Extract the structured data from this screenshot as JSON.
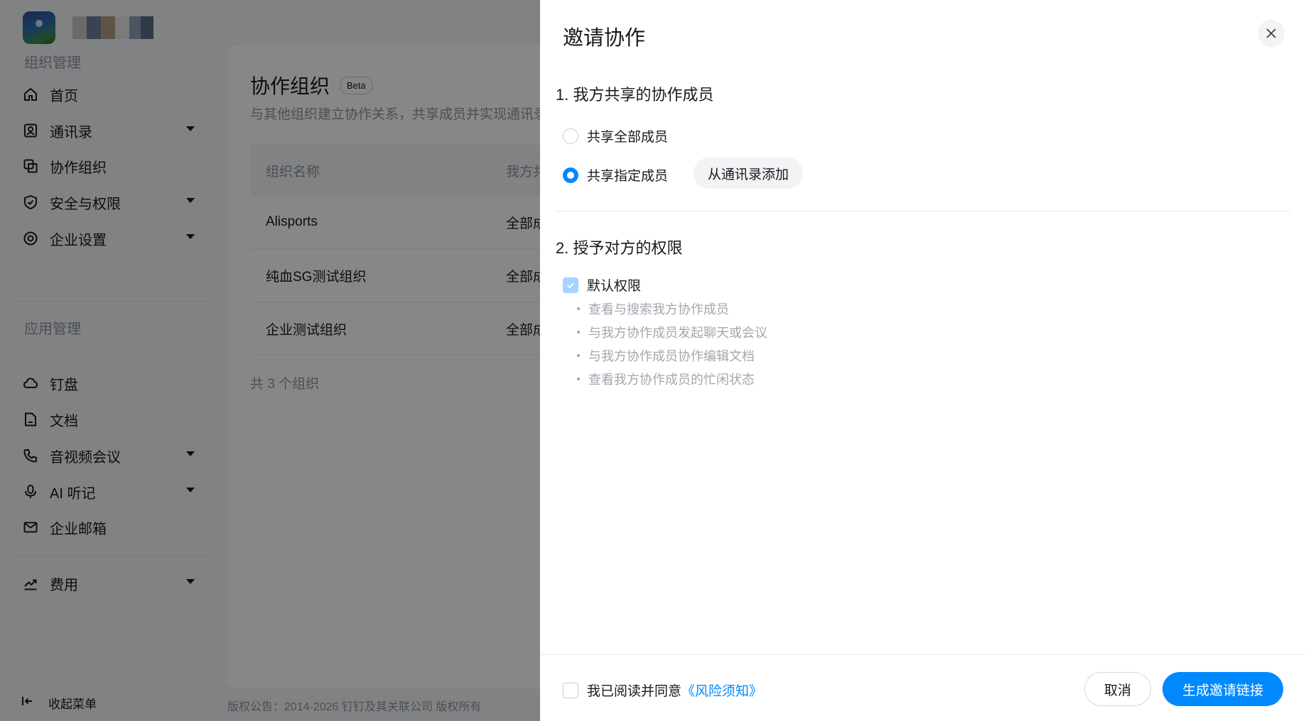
{
  "sidebar": {
    "group_org": "组织管理",
    "group_apps": "应用管理",
    "items": [
      {
        "label": "首页",
        "icon": "home-icon"
      },
      {
        "label": "通讯录",
        "icon": "contacts-icon"
      },
      {
        "label": "协作组织",
        "icon": "collab-org-icon"
      },
      {
        "label": "安全与权限",
        "icon": "shield-icon"
      },
      {
        "label": "企业设置",
        "icon": "settings-icon"
      },
      {
        "label": "钉盘",
        "icon": "cloud-icon"
      },
      {
        "label": "文档",
        "icon": "document-icon"
      },
      {
        "label": "音视频会议",
        "icon": "phone-icon"
      },
      {
        "label": "AI 听记",
        "icon": "microphone-icon"
      },
      {
        "label": "企业邮箱",
        "icon": "mail-icon"
      },
      {
        "label": "费用",
        "icon": "chart-trend-icon"
      }
    ],
    "collapse_label": "收起菜单"
  },
  "main": {
    "title": "协作组织",
    "badge": "Beta",
    "description": "与其他组织建立协作关系，共享成员并实现通讯录",
    "table": {
      "headers": [
        "组织名称",
        "我方共"
      ],
      "rows": [
        [
          "Alisports",
          "全部成"
        ],
        [
          "纯血SG测试组织",
          "全部成"
        ],
        [
          "企业测试组织",
          "全部成"
        ]
      ],
      "count": "共 3 个组织"
    },
    "copyright": "版权公告：2014-2026 钉钉及其关联公司 版权所有"
  },
  "drawer": {
    "title": "邀请协作",
    "section1": {
      "title": "1. 我方共享的协作成员",
      "option_all": "共享全部成员",
      "option_specific": "共享指定成员",
      "add_button": "从通讯录添加",
      "selected": "specific"
    },
    "section2": {
      "title": "2. 授予对方的权限",
      "default_label": "默认权限",
      "permissions": [
        "查看与搜索我方协作成员",
        "与我方协作成员发起聊天或会议",
        "与我方协作成员协作编辑文档",
        "查看我方协作成员的忙闲状态"
      ]
    },
    "footer": {
      "agree_text": "我已阅读并同意",
      "agree_link": "《风险须知》",
      "cancel": "取消",
      "submit": "生成邀请链接"
    }
  },
  "colors": {
    "accent": "#0089ff",
    "mask": "rgba(0,0,0,0.47)"
  }
}
